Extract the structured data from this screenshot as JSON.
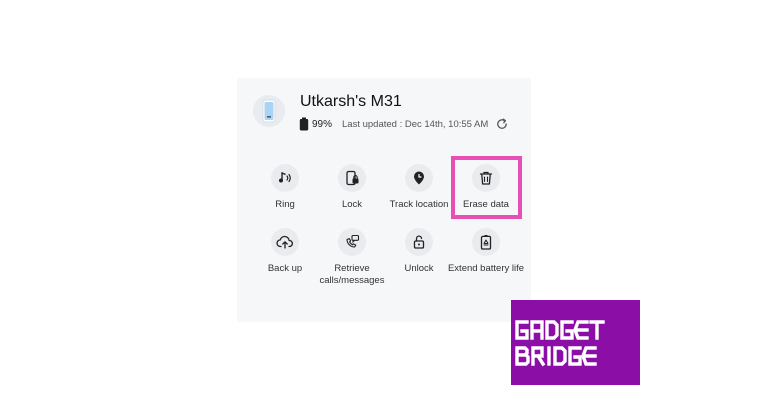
{
  "device": {
    "name": "Utkarsh's M31",
    "battery": "99%",
    "last_updated": "Last updated : Dec 14th, 10:55 AM"
  },
  "actions": [
    {
      "label": "Ring",
      "icon": "ring-icon"
    },
    {
      "label": "Lock",
      "icon": "lock-phone-icon"
    },
    {
      "label": "Track location",
      "icon": "location-pin-icon"
    },
    {
      "label": "Erase data",
      "icon": "trash-icon"
    },
    {
      "label": "Back up",
      "icon": "cloud-upload-icon"
    },
    {
      "label": "Retrieve calls/messages",
      "icon": "phone-message-icon"
    },
    {
      "label": "Unlock",
      "icon": "unlock-icon"
    },
    {
      "label": "Extend battery life",
      "icon": "battery-recycle-icon"
    }
  ],
  "highlighted_action": "Erase data",
  "colors": {
    "card_bg": "#f6f7f9",
    "highlight": "#e74fb5",
    "logo_bg": "#8b0fa7",
    "device_screen": "#a9d4f5"
  },
  "watermark": {
    "line1": "GADGET",
    "line2": "BRIDGE"
  }
}
